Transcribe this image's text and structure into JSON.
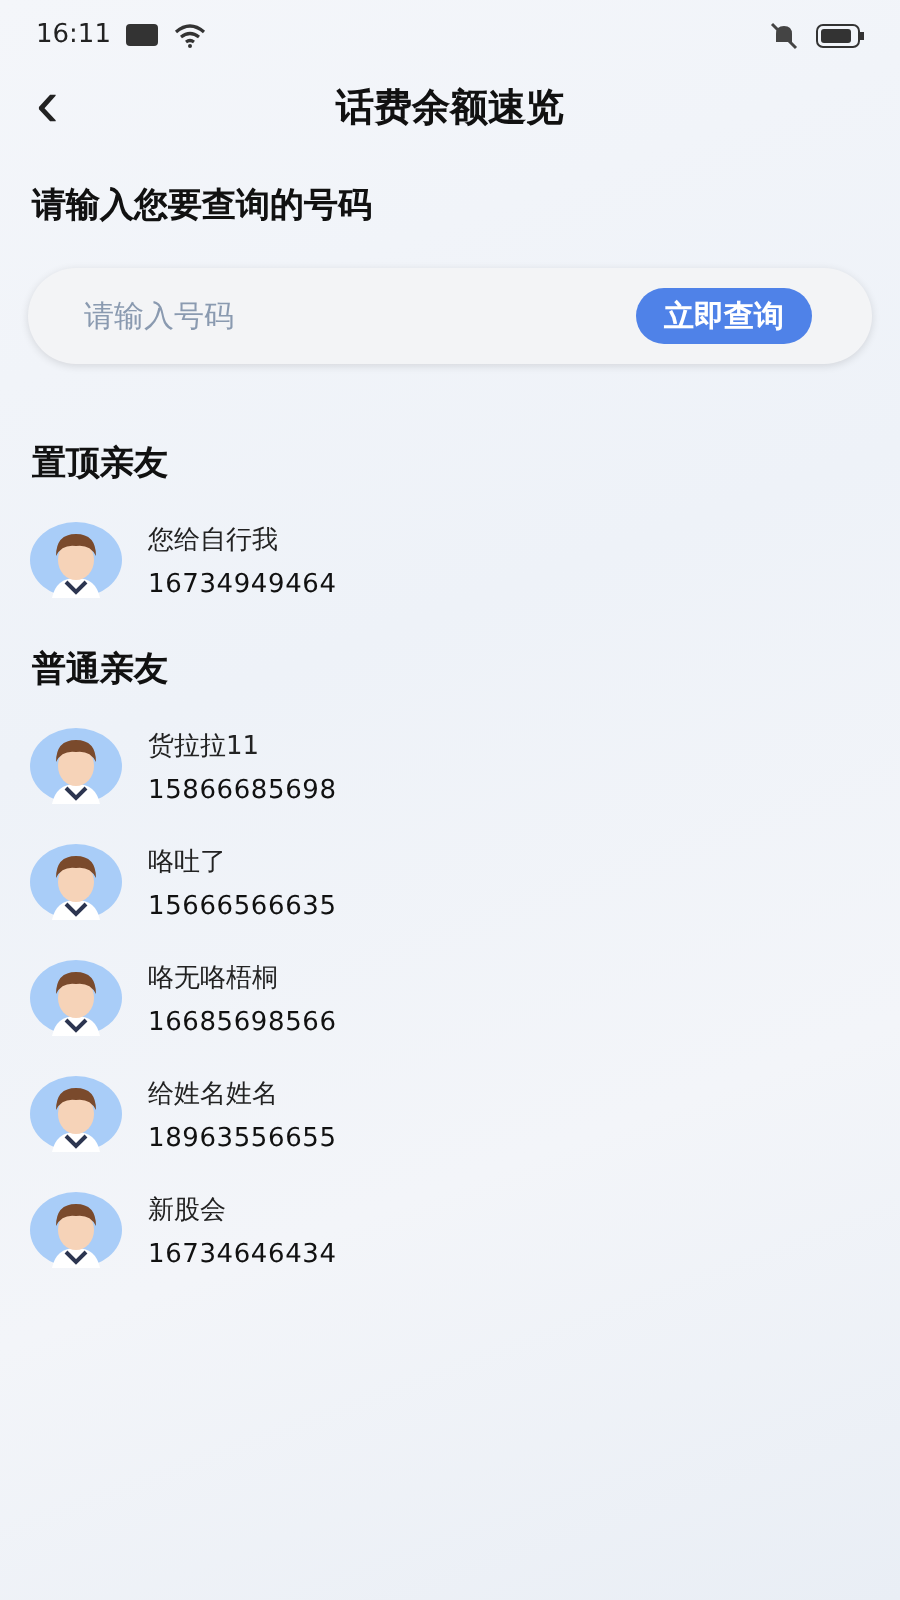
{
  "status_bar": {
    "time": "16:11"
  },
  "header": {
    "back": "‹",
    "title": "话费余额速览"
  },
  "query": {
    "label": "请输入您要查询的号码",
    "placeholder": "请输入号码",
    "button": "立即查询"
  },
  "pinned": {
    "title": "置顶亲友",
    "contacts": [
      {
        "name": "您给自行我",
        "phone": "16734949464"
      }
    ]
  },
  "regular": {
    "title": "普通亲友",
    "contacts": [
      {
        "name": "货拉拉11",
        "phone": "15866685698"
      },
      {
        "name": "咯吐了",
        "phone": "15666566635"
      },
      {
        "name": "咯无咯梧桐",
        "phone": "16685698566"
      },
      {
        "name": "给姓名姓名",
        "phone": "18963556655"
      },
      {
        "name": "新股会",
        "phone": "16734646434"
      }
    ]
  }
}
